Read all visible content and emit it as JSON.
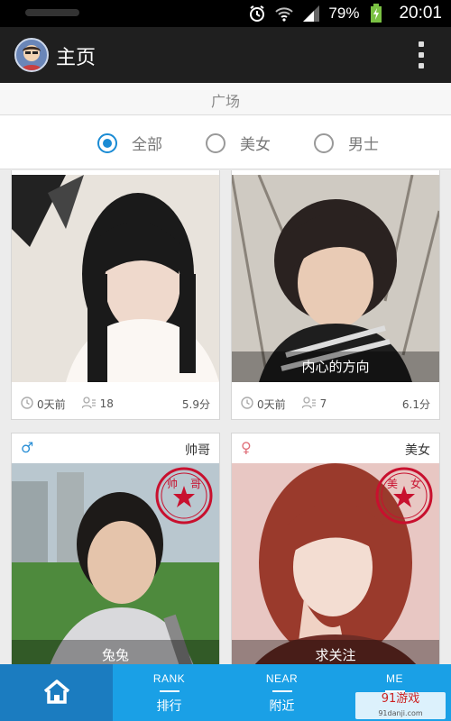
{
  "status_bar": {
    "battery": "79%",
    "time": "20:01"
  },
  "app_bar": {
    "title": "主页"
  },
  "section": {
    "title": "广场"
  },
  "filter": {
    "options": [
      {
        "label": "全部",
        "checked": true
      },
      {
        "label": "美女",
        "checked": false
      },
      {
        "label": "男士",
        "checked": false
      }
    ]
  },
  "cards": [
    {
      "caption": "",
      "time": "0天前",
      "fans": "18",
      "score": "5.9分"
    },
    {
      "caption": "内心的方向",
      "time": "0天前",
      "fans": "7",
      "score": "6.1分"
    },
    {
      "gender": "♂",
      "tag": "帅哥",
      "caption": "兔兔",
      "stamp": "帅哥"
    },
    {
      "gender": "♀",
      "tag": "美女",
      "caption": "求关注",
      "stamp": "美女"
    }
  ],
  "tabs": [
    {
      "en": "",
      "cn": "",
      "icon": "home-icon"
    },
    {
      "en": "RANK",
      "cn": "排行"
    },
    {
      "en": "NEAR",
      "cn": "附近"
    },
    {
      "en": "ME",
      "cn": ""
    }
  ],
  "watermark": {
    "brand": "91游戏",
    "site": "91danji.com"
  },
  "colors": {
    "accent": "#1a8bd4",
    "tabbar": "#1aa0e6",
    "tab_active": "#1b7cc0",
    "appbar": "#1f1f1f",
    "male": "#2a8fd6",
    "female": "#e0707a"
  }
}
